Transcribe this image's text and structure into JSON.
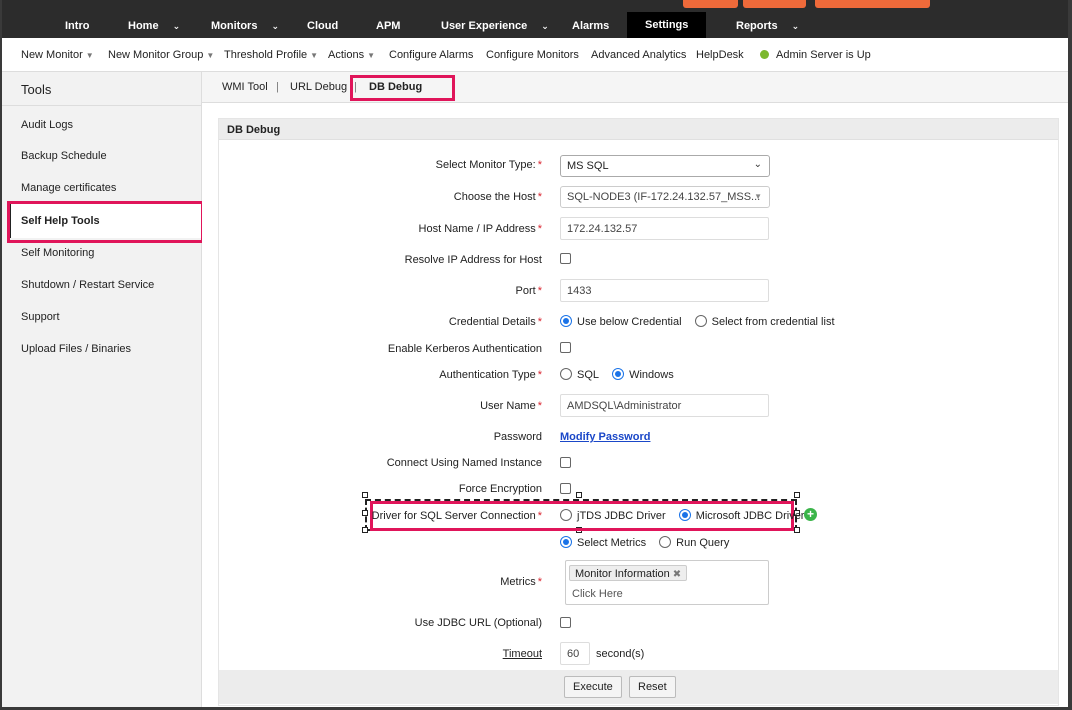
{
  "topnav": {
    "items": [
      {
        "label": "Intro"
      },
      {
        "label": "Home",
        "chevron": true
      },
      {
        "label": "Monitors",
        "chevron": true
      },
      {
        "label": "Cloud"
      },
      {
        "label": "APM"
      },
      {
        "label": "User Experience",
        "chevron": true
      },
      {
        "label": "Alarms"
      },
      {
        "label": "Settings",
        "active": true
      },
      {
        "label": "Reports",
        "chevron": true
      }
    ]
  },
  "subnav": {
    "items": [
      {
        "label": "New Monitor",
        "caret": true
      },
      {
        "label": "New Monitor Group",
        "caret": true
      },
      {
        "label": "Threshold Profile",
        "caret": true
      },
      {
        "label": "Actions",
        "caret": true
      },
      {
        "label": "Configure Alarms"
      },
      {
        "label": "Configure Monitors"
      },
      {
        "label": "Advanced Analytics"
      },
      {
        "label": "HelpDesk"
      }
    ],
    "status": "Admin Server is Up",
    "status_color": "#7cb82f"
  },
  "sidebar": {
    "title": "Tools",
    "items": [
      {
        "label": "Audit Logs"
      },
      {
        "label": "Backup Schedule"
      },
      {
        "label": "Manage certificates"
      },
      {
        "label": "Self Help Tools",
        "selected": true
      },
      {
        "label": "Self Monitoring"
      },
      {
        "label": "Shutdown / Restart Service"
      },
      {
        "label": "Support"
      },
      {
        "label": "Upload Files / Binaries"
      }
    ]
  },
  "tabs": {
    "items": [
      {
        "label": "WMI Tool"
      },
      {
        "label": "URL Debug"
      },
      {
        "label": "DB Debug",
        "active": true
      }
    ],
    "separator": "|"
  },
  "panel": {
    "title": "DB Debug",
    "fields": {
      "monitor_type": {
        "label": "Select Monitor Type:",
        "required": true,
        "value": "MS SQL"
      },
      "host": {
        "label": "Choose the Host",
        "required": true,
        "value": "SQL-NODE3 (IF-172.24.132.57_MSS..."
      },
      "host_ip": {
        "label": "Host Name / IP Address",
        "required": true,
        "value": "172.24.132.57"
      },
      "resolve_ip": {
        "label": "Resolve IP Address for Host",
        "checked": false
      },
      "port": {
        "label": "Port",
        "required": true,
        "value": "1433"
      },
      "credential": {
        "label": "Credential Details",
        "required": true,
        "options": [
          "Use below Credential",
          "Select from credential list"
        ],
        "selected": "Use below Credential"
      },
      "kerberos": {
        "label": "Enable Kerberos Authentication",
        "checked": false
      },
      "auth_type": {
        "label": "Authentication Type",
        "required": true,
        "options": [
          "SQL",
          "Windows"
        ],
        "selected": "Windows"
      },
      "username": {
        "label": "User Name",
        "required": true,
        "value": "AMDSQL\\Administrator"
      },
      "password": {
        "label": "Password",
        "link": "Modify Password"
      },
      "named_instance": {
        "label": "Connect Using Named Instance",
        "checked": false
      },
      "force_encryption": {
        "label": "Force Encryption",
        "checked": false
      },
      "driver": {
        "label": "Driver for SQL Server Connection",
        "required": true,
        "options": [
          "jTDS JDBC Driver",
          "Microsoft JDBC Driver"
        ],
        "selected": "Microsoft JDBC Driver"
      },
      "query_mode": {
        "options": [
          "Select Metrics",
          "Run Query"
        ],
        "selected": "Select Metrics"
      },
      "metrics": {
        "label": "Metrics",
        "required": true,
        "chip": "Monitor Information",
        "chip_remove": "✖",
        "placeholder": "Click Here"
      },
      "jdbc_url": {
        "label": "Use JDBC URL (Optional)",
        "checked": false
      },
      "timeout": {
        "label": "Timeout",
        "value": "60",
        "unit": "second(s)"
      }
    },
    "buttons": {
      "execute": "Execute",
      "reset": "Reset"
    }
  },
  "colors": {
    "highlight": "#e0155a",
    "accent": "#1a73e8",
    "orange": "#ef6a3a",
    "nav_bg": "#2c2c2c"
  },
  "icons": {
    "chevron": "chevron-down-icon",
    "plus": "plus-circle-icon",
    "remove": "close-icon",
    "status_dot": "status-dot-icon"
  }
}
